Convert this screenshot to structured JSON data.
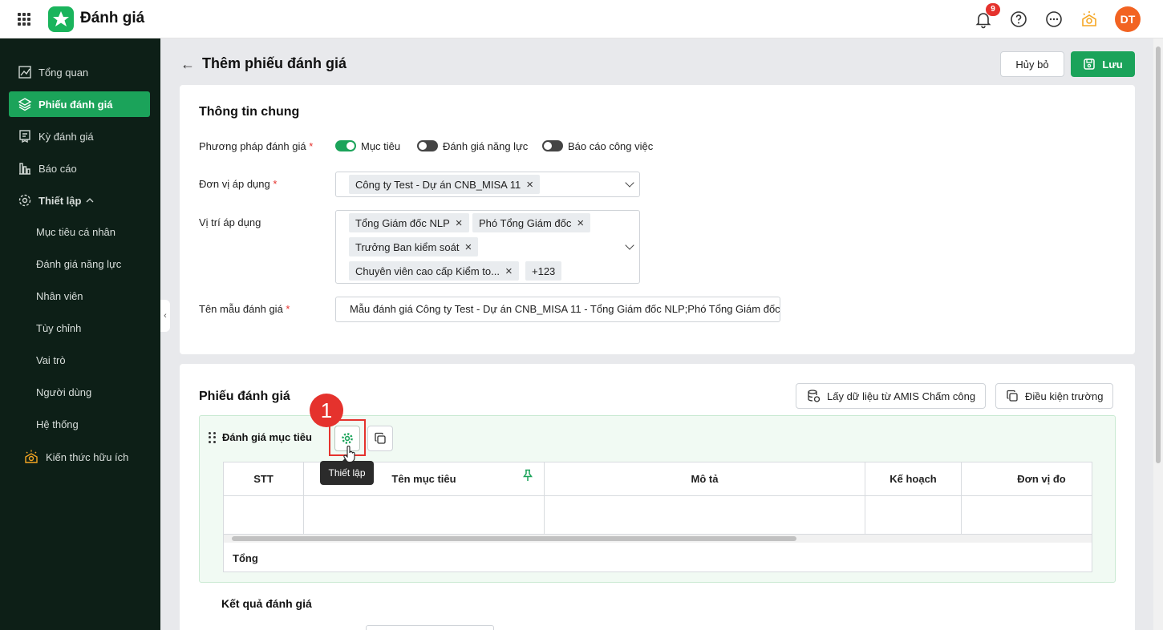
{
  "app": {
    "title": "Đánh giá",
    "notification_count": "9",
    "avatar_initials": "DT"
  },
  "sidebar": {
    "items": [
      {
        "label": "Tổng quan",
        "icon": "chart-icon"
      },
      {
        "label": "Phiếu đánh giá",
        "icon": "layers-icon",
        "active": true
      },
      {
        "label": "Kỳ đánh giá",
        "icon": "clipboard-icon"
      },
      {
        "label": "Báo cáo",
        "icon": "bar-chart-icon"
      },
      {
        "label": "Thiết lập",
        "icon": "gear-icon",
        "expanded": true
      }
    ],
    "sub_items": [
      "Mục tiêu cá nhân",
      "Đánh giá năng lực",
      "Nhân viên",
      "Tùy chỉnh",
      "Vai trò",
      "Người dùng",
      "Hệ thống"
    ],
    "knowledge": "Kiến thức hữu ích"
  },
  "header": {
    "title": "Thêm phiếu đánh giá",
    "cancel_label": "Hủy bỏ",
    "save_label": "Lưu"
  },
  "general": {
    "title": "Thông tin chung",
    "method_label": "Phương pháp đánh giá",
    "method_options": [
      {
        "label": "Mục tiêu",
        "on": true
      },
      {
        "label": "Đánh giá năng lực",
        "on": false
      },
      {
        "label": "Báo cáo công việc",
        "on": false
      }
    ],
    "unit_label": "Đơn vị áp dụng",
    "unit_chips": [
      "Công ty Test - Dự án CNB_MISA 11"
    ],
    "position_label": "Vị trí áp dụng",
    "position_chips": [
      "Tổng Giám đốc NLP",
      "Phó Tổng Giám đốc",
      "Trưởng Ban kiểm soát",
      "Chuyên viên cao cấp Kiểm to..."
    ],
    "position_more": "+123",
    "template_label": "Tên mẫu đánh giá",
    "template_value": "Mẫu đánh giá Công ty Test - Dự án CNB_MISA 11 - Tổng Giám đốc NLP;Phó Tổng Giám đốc"
  },
  "form": {
    "title": "Phiếu đánh giá",
    "fetch_button": "Lấy dữ liệu từ AMIS Chấm công",
    "condition_button": "Điều kiện trường",
    "section_title": "Đánh giá mục tiêu",
    "tooltip": "Thiết lập",
    "step_number": "1",
    "columns": [
      "STT",
      "Tên mục tiêu",
      "Mô tả",
      "Kế hoạch",
      "Đơn vị đo"
    ],
    "total_label": "Tổng",
    "result_title": "Kết quả đánh giá"
  },
  "colors": {
    "brand": "#1ba35a",
    "sidebar_bg": "#0d1f17",
    "highlight": "#e5322d",
    "avatar": "#f26322"
  }
}
